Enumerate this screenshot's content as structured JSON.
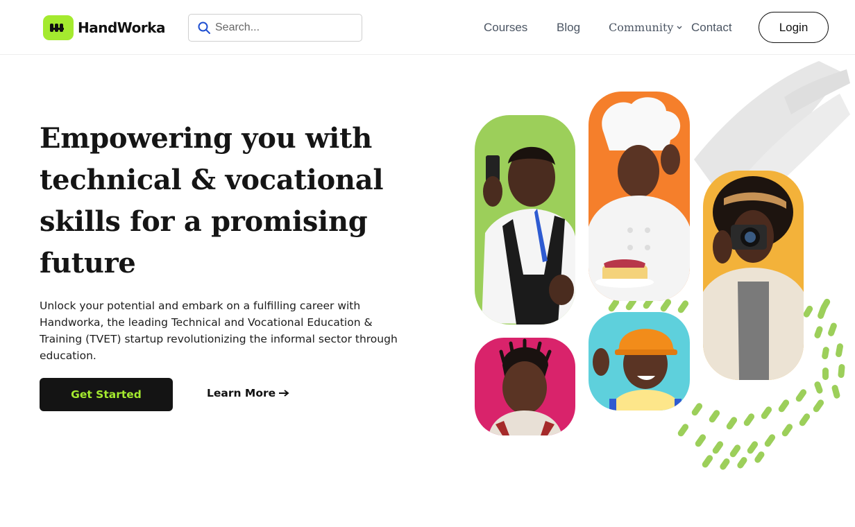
{
  "brand": {
    "name": "HandWorka",
    "accent": "#a4ea2f",
    "dark": "#141414"
  },
  "search": {
    "placeholder": "Search...",
    "icon": "search-icon"
  },
  "nav": {
    "courses": "Courses",
    "blog": "Blog",
    "community": "Community",
    "contact": "Contact",
    "login": "Login"
  },
  "hero": {
    "title_lines": [
      "Empowering you with",
      "technical & vocational",
      "skills for a promising",
      "future"
    ],
    "description": "Unlock your potential and embark on a fulfilling career with Handworka, the leading Technical and Vocational Education & Training (TVET) startup revolutionizing the informal sector through education.",
    "primary_button": "Get Started",
    "secondary_button": "Learn More",
    "secondary_icon": "arrow-right-icon"
  },
  "collage": {
    "photos": [
      {
        "subject": "barber with clippers",
        "bg": "#9ccf5a"
      },
      {
        "subject": "chef with cake",
        "bg": "#f57f2b"
      },
      {
        "subject": "photographer with camera",
        "bg": "#f3b23a"
      },
      {
        "subject": "smiling girl",
        "bg": "#d9236b"
      },
      {
        "subject": "construction worker with hard hat",
        "bg": "#5ed0dc"
      }
    ],
    "dots_color": "#9ccf5a",
    "brush_color": "#e3e3e3"
  }
}
